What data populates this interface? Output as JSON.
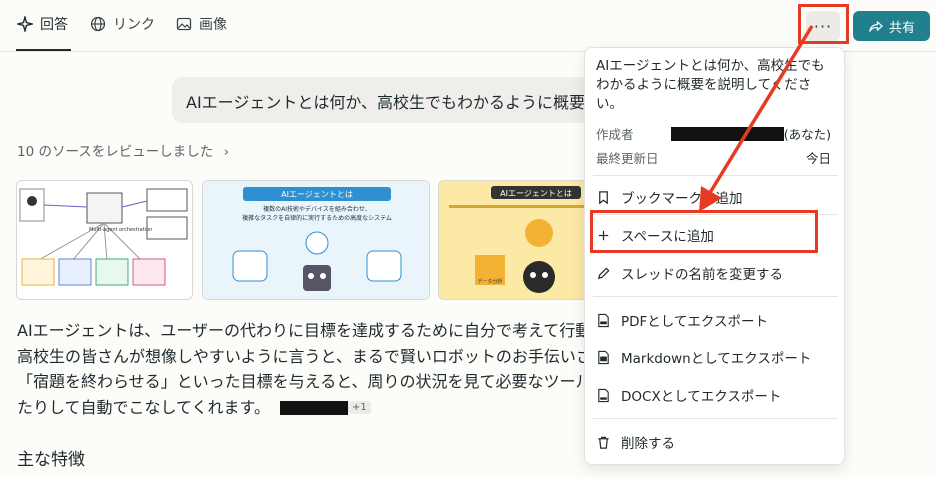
{
  "tabs": [
    {
      "label": "回答",
      "icon": "sparkle-icon"
    },
    {
      "label": "リンク",
      "icon": "globe-icon"
    },
    {
      "label": "画像",
      "icon": "image-icon"
    }
  ],
  "toolbar": {
    "more_label": "···",
    "share_label": "共有"
  },
  "query": "AIエージェントとは何か、高校生でもわかるように概要を説明してください。",
  "sources_text": "10 のソースをレビューしました",
  "thumbnails": [
    {
      "caption": "Multi-agent orchestration"
    },
    {
      "title": "AIエージェントとは",
      "line1": "複数のAI技術やデバイスを組み合わせ、",
      "line2": "複雑なタスクを自律的に実行するための高度なシステム"
    },
    {
      "title": "AIエージェントとは",
      "label": "データ分析"
    }
  ],
  "answer": {
    "line1": "AIエージェントは、ユーザーの代わりに目標を達成するために自分で考えて行動",
    "line2": "高校生の皆さんが想像しやすいように言うと、まるで賢いロボットのお手伝いさ",
    "line3": "「宿題を終わらせる」といった目標を与えると、周りの状況を見て必要なツール",
    "line4": "たりして自動でこなしてくれます。",
    "cite_more": "+1"
  },
  "section_heading": "主な特徴",
  "menu": {
    "title": "AIエージェントとは何か、高校生でもわかるように概要を説明してください。",
    "author_label": "作成者",
    "author_suffix": "(あなた)",
    "updated_label": "最終更新日",
    "updated_value": "今日",
    "items": [
      {
        "label": "ブックマークに追加",
        "icon": "bookmark-icon"
      },
      {
        "label": "スペースに追加",
        "icon": "plus-icon"
      },
      {
        "label": "スレッドの名前を変更する",
        "icon": "pencil-icon"
      },
      {
        "label": "PDFとしてエクスポート",
        "icon": "pdf-file-icon"
      },
      {
        "label": "Markdownとしてエクスポート",
        "icon": "markdown-file-icon"
      },
      {
        "label": "DOCXとしてエクスポート",
        "icon": "docx-file-icon"
      },
      {
        "label": "削除する",
        "icon": "trash-icon"
      }
    ]
  },
  "colors": {
    "accent": "#20808d",
    "annotation": "#e53b25"
  }
}
